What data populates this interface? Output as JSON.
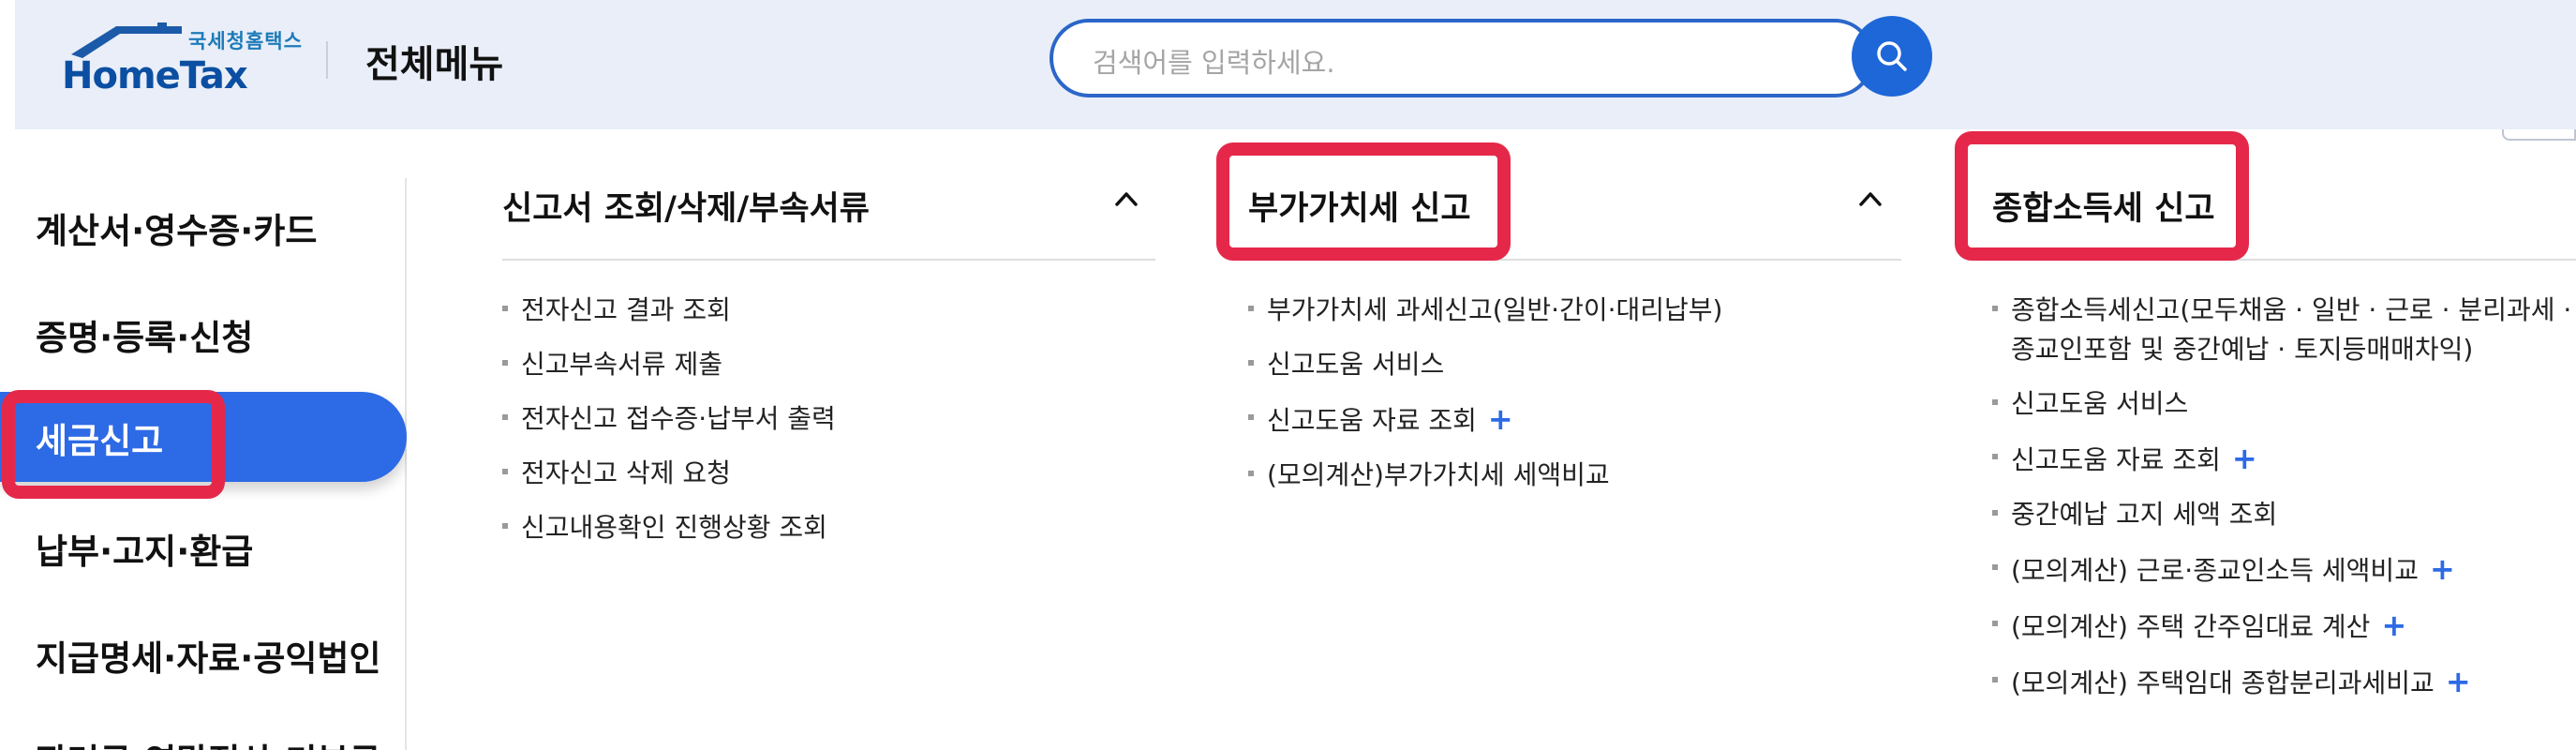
{
  "header": {
    "logo_sub": "국세청홈택스",
    "logo_main": "HomeTax",
    "page_title": "전체메뉴",
    "search_placeholder": "검색어를 입력하세요."
  },
  "sidebar": {
    "items": [
      {
        "label": "계산서·영수증·카드"
      },
      {
        "label": "증명·등록·신청"
      },
      {
        "label": "세금신고",
        "active": true
      },
      {
        "label": "납부·고지·환급"
      },
      {
        "label": "지급명세·자료·공익법인"
      },
      {
        "label": "장려금·연말정산·기부금"
      }
    ]
  },
  "columns": [
    {
      "title": "신고서 조회/삭제/부속서류",
      "expanded": true,
      "items": [
        {
          "label": "전자신고 결과 조회"
        },
        {
          "label": "신고부속서류 제출"
        },
        {
          "label": "전자신고 접수증·납부서 출력"
        },
        {
          "label": "전자신고 삭제 요청"
        },
        {
          "label": "신고내용확인 진행상황 조회"
        }
      ]
    },
    {
      "title": "부가가치세 신고",
      "expanded": true,
      "items": [
        {
          "label": "부가가치세 과세신고(일반·간이·대리납부)"
        },
        {
          "label": "신고도움 서비스"
        },
        {
          "label": "신고도움 자료 조회",
          "plus": "+"
        },
        {
          "label": "(모의계산)부가가치세 세액비교"
        }
      ]
    },
    {
      "title": "종합소득세 신고",
      "items": [
        {
          "label": "종합소득세신고(모두채움 · 일반 · 근로 · 분리과세 ·",
          "label2": "종교인포함 및 중간예납 · 토지등매매차익)"
        },
        {
          "label": "신고도움 서비스"
        },
        {
          "label": "신고도움 자료 조회",
          "plus": "+"
        },
        {
          "label": "중간예납 고지 세액 조회"
        },
        {
          "label": "(모의계산) 근로·종교인소득 세액비교",
          "plus": "+"
        },
        {
          "label": "(모의계산) 주택 간주임대료 계산",
          "plus": "+"
        },
        {
          "label": "(모의계산) 주택임대 종합분리과세비교",
          "plus": "+"
        }
      ]
    }
  ],
  "colors": {
    "accent": "#2d6ae5",
    "highlight": "#e5284a",
    "header_bg": "#e9eef8"
  }
}
